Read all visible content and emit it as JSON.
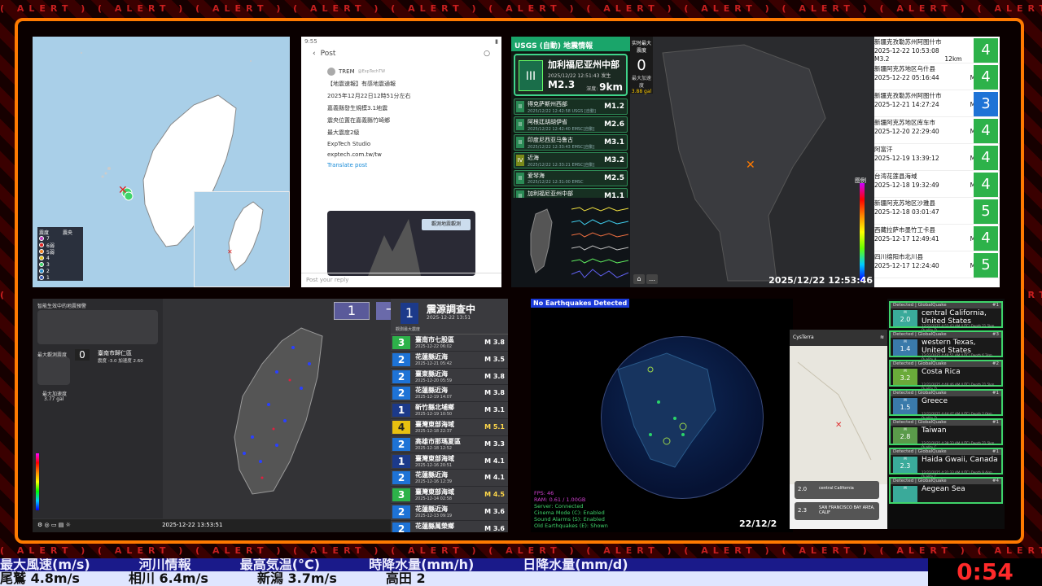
{
  "alert_text": "ALERT",
  "panel_map1": {
    "legend_header_intensity": "震度",
    "legend_header_epicenter": "震央",
    "legend_levels": [
      "7",
      "6弱",
      "5弱",
      "4",
      "3",
      "2",
      "1"
    ]
  },
  "panel_post": {
    "status_left": "9:55",
    "header_label": "Post",
    "handle": "TREM",
    "handle_sub": "@ExpTechTW",
    "lines": [
      "【地震速報】有感地震通報",
      "2025年12月22日12時51分左右",
      "嘉義縣發生規模3.1地震",
      "震央位置在嘉義縣竹崎鄉",
      "最大震度2級",
      "ExpTech Studio",
      "exptech.com.tw/tw"
    ],
    "link_text": "Translate post",
    "image_button": "觀測地震觀測",
    "reply_placeholder": "Post your reply"
  },
  "panel_usgs": {
    "header": "USGS (自動) 地震情報",
    "main": {
      "intensity": "III",
      "location": "加利福尼亚州中部",
      "time": "2025/12/22 12:51:43 发生",
      "magnitude": "M2.3",
      "depth_label": "深度:",
      "depth": "9km"
    },
    "rows": [
      {
        "i": "II",
        "name": "得克萨斯州西部",
        "date": "2025/12/22 12:42:58",
        "src": "USGS [自動]",
        "mag": "M1.2",
        "yellow": false
      },
      {
        "i": "II",
        "name": "阿根廷胡胡伊省",
        "date": "2025/12/22 12:42:40",
        "src": "EMSC[自動]",
        "mag": "M2.6",
        "yellow": false
      },
      {
        "i": "II",
        "name": "印度尼西亚马鲁古",
        "date": "2025/12/22 12:33:43",
        "src": "EMSC[自動]",
        "mag": "M3.1",
        "yellow": false
      },
      {
        "i": "IV",
        "name": "近海",
        "date": "2025/12/22 12:33:21",
        "src": "EMSC[自動]",
        "mag": "M3.2",
        "yellow": true
      },
      {
        "i": "II",
        "name": "爱琴海",
        "date": "2025/12/22 12:31:00",
        "src": "EMSC",
        "mag": "M2.5",
        "yellow": false
      },
      {
        "i": "II",
        "name": "加利福尼亚州中部",
        "date": "2025/12/22 12:32:25",
        "src": "USGS [自動]",
        "mag": "M1.1",
        "yellow": false
      }
    ]
  },
  "panel_world": {
    "pga_label": "实时最大震度",
    "pga_value": "0",
    "pga_unit": "最大加速度",
    "pga_gal": "3.88 gal",
    "legend_label": "图例",
    "timestamp": "2025/12/22 12:53:46"
  },
  "panel_list": {
    "rows": [
      {
        "loc": "新疆克孜勒苏州阿图什市",
        "time": "2025-12-22 10:53:08",
        "mag": "",
        "shindo": "4",
        "color": "#2db24a"
      },
      {
        "loc": "新疆阿克苏地区乌什县",
        "time": "2025-12-22 05:16:44",
        "mag": "M4.2",
        "shindo": "4",
        "color": "#2db24a"
      },
      {
        "loc": "新疆克孜勒苏州阿图什市",
        "time": "2025-12-21 14:27:24",
        "mag": "M3.1",
        "shindo": "3",
        "color": "#1e73d6"
      },
      {
        "loc": "新疆阿克苏地区库车市",
        "time": "2025-12-20 22:29:40",
        "mag": "M3.6",
        "shindo": "4",
        "color": "#2db24a"
      },
      {
        "loc": "阿富汗",
        "time": "2025-12-19 13:39:12",
        "mag": "M5.2",
        "shindo": "4",
        "color": "#2db24a"
      },
      {
        "loc": "台湾花莲县海域",
        "time": "2025-12-18 19:32:49",
        "mag": "M4.1",
        "shindo": "4",
        "color": "#2db24a"
      },
      {
        "loc": "新疆阿克苏地区沙雅县",
        "time": "2025-12-18 03:01:47",
        "mag": "M4",
        "shindo": "5",
        "color": "#2db24a"
      },
      {
        "loc": "西藏拉萨市墨竹工卡县",
        "time": "2025-12-17 12:49:41",
        "mag": "M3.2",
        "shindo": "4",
        "color": "#2db24a"
      },
      {
        "loc": "四川绵阳市北川县",
        "time": "2025-12-17 12:24:40",
        "mag": "M3.7",
        "shindo": "5",
        "color": "#2db24a"
      }
    ],
    "first_row_extra": {
      "mag": "M3.2",
      "depth": "12km"
    }
  },
  "panel_tw": {
    "warn_title": "智能生效中的地震預警",
    "site_label": "最大觀測震度",
    "site_value": "0",
    "site_name": "臺南市歸仁區",
    "site_sub": "震度 -3.0  加速度 2.60",
    "max_acc_label": "最大加速度",
    "max_acc": "3.77 gal",
    "intensity_box": "1",
    "eq_box": "一",
    "footer_time": "2025-12-22 13:53:51",
    "report": {
      "num": "1",
      "title": "震源調查中",
      "date": "2025-12-22 13:51",
      "sub": "觀測最大震度"
    },
    "rows": [
      {
        "n": "3",
        "loc": "臺南市七股區",
        "date": "2025-12-22 06:02",
        "mag": "M 3.8",
        "c": "#2db24a",
        "mc": "#fff"
      },
      {
        "n": "2",
        "loc": "花蓮縣近海",
        "date": "2025-12-21 05:42",
        "mag": "M 3.5",
        "c": "#1e73d6",
        "mc": "#fff"
      },
      {
        "n": "2",
        "loc": "臺東縣近海",
        "date": "2025-12-20 05:59",
        "mag": "M 3.8",
        "c": "#1e73d6",
        "mc": "#fff"
      },
      {
        "n": "2",
        "loc": "花蓮縣近海",
        "date": "2025-12-19 14:07",
        "mag": "M 3.8",
        "c": "#1e73d6",
        "mc": "#fff"
      },
      {
        "n": "1",
        "loc": "新竹縣北埔鄉",
        "date": "2025-12-19 10:50",
        "mag": "M 3.1",
        "c": "#1c3a8a",
        "mc": "#fff"
      },
      {
        "n": "4",
        "loc": "臺灣東部海域",
        "date": "2025-12-18 22:37",
        "mag": "M 5.1",
        "c": "#e8c010",
        "mc": "#ffd84a"
      },
      {
        "n": "2",
        "loc": "高雄市那瑪夏區",
        "date": "2025-12-18 12:52",
        "mag": "M 3.3",
        "c": "#1e73d6",
        "mc": "#fff"
      },
      {
        "n": "1",
        "loc": "臺灣東部海域",
        "date": "2025-12-16 20:51",
        "mag": "M 4.1",
        "c": "#1c3a8a",
        "mc": "#fff"
      },
      {
        "n": "2",
        "loc": "花蓮縣近海",
        "date": "2025-12-16 12:39",
        "mag": "M 4.1",
        "c": "#1e73d6",
        "mc": "#fff"
      },
      {
        "n": "3",
        "loc": "臺灣東部海域",
        "date": "2025-12-14 02:58",
        "mag": "M 4.5",
        "c": "#2db24a",
        "mc": "#ffd84a"
      },
      {
        "n": "2",
        "loc": "花蓮縣近海",
        "date": "2025-12-13 09:19",
        "mag": "M 3.6",
        "c": "#1e73d6",
        "mc": "#fff"
      },
      {
        "n": "2",
        "loc": "花蓮縣萬榮鄉",
        "date": "",
        "mag": "M 3.6",
        "c": "#1e73d6",
        "mc": "#fff"
      }
    ]
  },
  "panel_globe": {
    "header": "No Earthquakes Detected",
    "stats": [
      {
        "t": "FPS: 46",
        "c": "#d040d0"
      },
      {
        "t": "RAM: 0.61 / 1.00GB",
        "c": "#d040d0"
      },
      {
        "t": "Server: Connected",
        "c": "#3fd46a"
      },
      {
        "t": "Cinema Mode (C): Enabled",
        "c": "#3fd46a"
      },
      {
        "t": "Sound Alarms (S): Enabled",
        "c": "#3fd46a"
      },
      {
        "t": "Old Earthquakes (E): Shown",
        "c": "#3fd46a"
      }
    ],
    "time": "22/12/2"
  },
  "panel_app": {
    "title": "CysTerra",
    "card1_place": "central California",
    "card1_mag": "2.0",
    "card2_place": "SAN FRANCISCO BAY AREA, CALIF",
    "card2_mag": "2.3"
  },
  "panel_gq": {
    "items": [
      {
        "src": "Detected | GlobalQuake",
        "rank": "#1",
        "mag": "2.0",
        "loc": "central California,",
        "loc2": "United States",
        "det": "12/22/2025 4:51:43 AM (UTC)  Depth 21.5km  Quality D",
        "c": "#3fd46a",
        "mc": "#3aaa9a"
      },
      {
        "src": "Detected | GlobalQuake",
        "rank": "#3",
        "mag": "1.4",
        "loc": "western Texas,",
        "loc2": "United States",
        "det": "12/22/2025 4:49:51 AM (UTC)  Depth 6.2km  Quality A",
        "c": "#3fd46a",
        "mc": "#3a7aaa"
      },
      {
        "src": "Detected | GlobalQuake",
        "rank": "#2",
        "mag": "3.2",
        "loc": "Costa Rica",
        "loc2": "",
        "det": "12/22/2025 4:46:46 AM (UTC)  Depth 21.5km  Quality D",
        "c": "#3fd46a",
        "mc": "#6aaa3a"
      },
      {
        "src": "Detected | GlobalQuake",
        "rank": "#1",
        "mag": "1.5",
        "loc": "Greece",
        "loc2": "",
        "det": "12/22/2025 4:44:47 AM (UTC)  Depth 2.0km  Quality D",
        "c": "#3fd46a",
        "mc": "#3a7aaa"
      },
      {
        "src": "Detected | GlobalQuake",
        "rank": "#1",
        "mag": "2.8",
        "loc": "Taiwan",
        "loc2": "",
        "det": "12/22/2025 4:38:33 AM (UTC)  Depth 21.5km  Quality C",
        "c": "#3fd46a",
        "mc": "#5a9a4a"
      },
      {
        "src": "Detected | GlobalQuake",
        "rank": "#1",
        "mag": "2.3",
        "loc": "Haida Gwaii, Canada",
        "loc2": "",
        "det": "12/22/2025 4:31:33 AM (UTC)  Depth 9.4km  Quality C",
        "c": "#3fd46a",
        "mc": "#3aaa9a"
      },
      {
        "src": "Detected | GlobalQuake",
        "rank": "#4",
        "mag": "",
        "loc": "Aegean Sea",
        "loc2": "",
        "det": "",
        "c": "#3fd46a",
        "mc": "#3aaa9a"
      }
    ]
  },
  "ticker": {
    "top": [
      "最大風速(m/s)",
      "河川情報",
      "最高気温(°C)",
      "時降水量(mm/h)",
      "日降水量(mm/d)"
    ],
    "bottom": [
      "尾鷲 4.8m/s",
      "相川 6.4m/s",
      "新潟 3.7m/s",
      "高田 2"
    ],
    "clock": "0:54"
  }
}
